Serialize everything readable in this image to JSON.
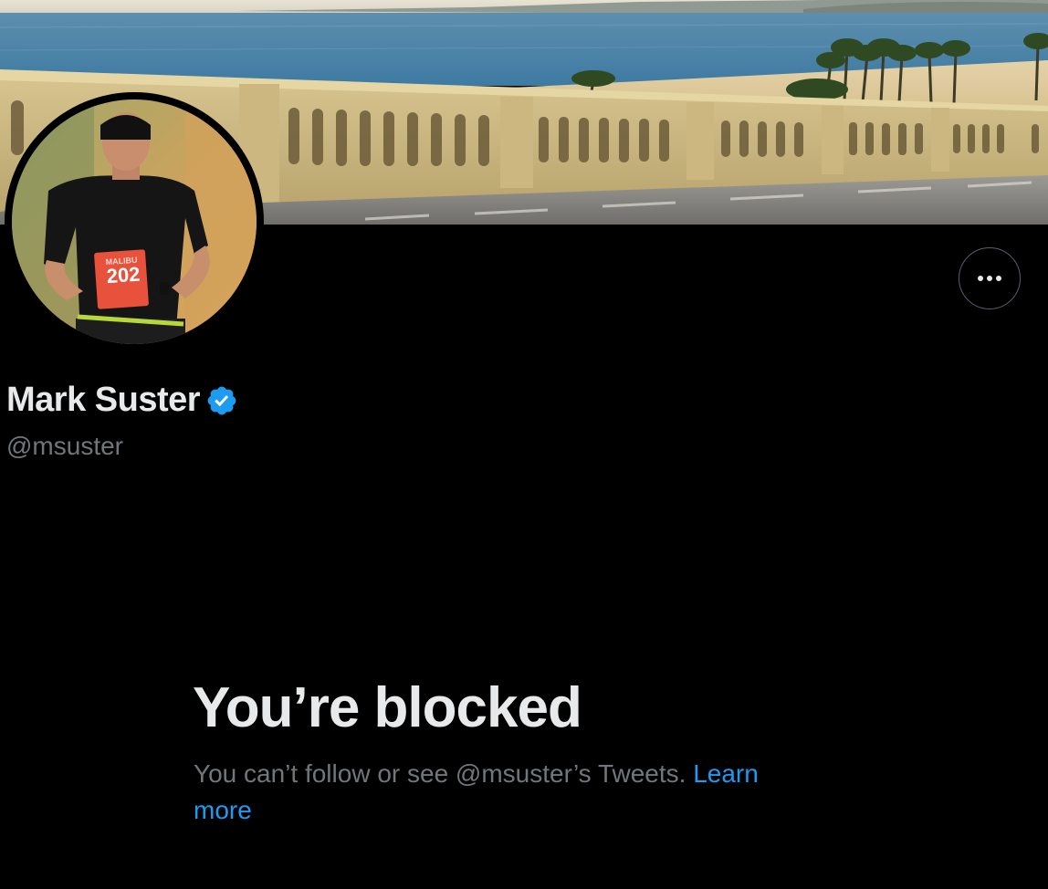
{
  "profile": {
    "display_name": "Mark Suster",
    "handle": "@msuster",
    "verified": true,
    "avatar_icon": "runner-avatar-photo",
    "banner_icon": "beach-balustrade-photo"
  },
  "actions": {
    "more_icon": "ellipsis-icon"
  },
  "blocked": {
    "title": "You’re blocked",
    "message": "You can’t follow or see @msuster’s Tweets.",
    "learn_more_label": "Learn more"
  },
  "colors": {
    "background": "#000000",
    "primary_text": "#e7e9ea",
    "secondary_text": "#71767b",
    "accent": "#1d9bf0",
    "border": "#536471"
  }
}
